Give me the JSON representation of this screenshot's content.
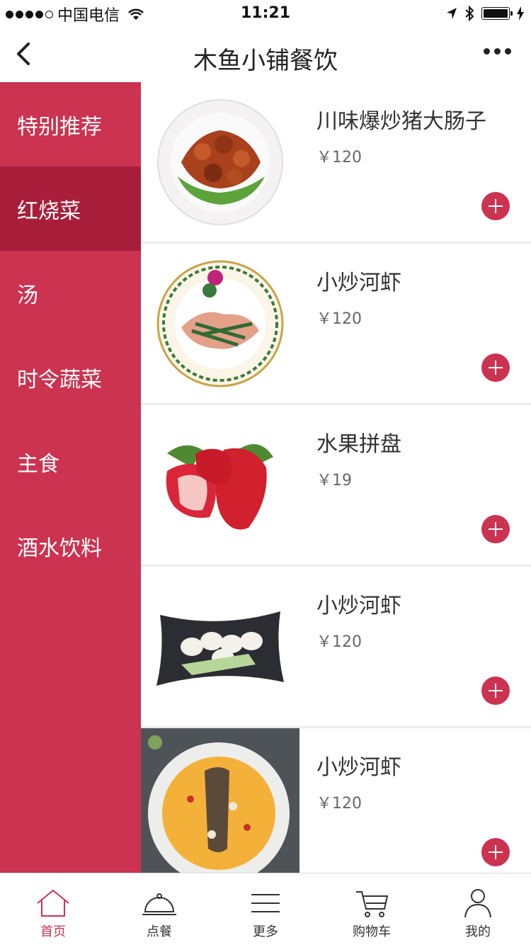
{
  "status": {
    "carrier": "中国电信",
    "time": "11:21"
  },
  "nav": {
    "title": "木鱼小铺餐饮"
  },
  "sidebar": {
    "items": [
      {
        "label": "特别推荐"
      },
      {
        "label": "红烧菜"
      },
      {
        "label": "汤"
      },
      {
        "label": "时令蔬菜"
      },
      {
        "label": "主食"
      },
      {
        "label": "酒水饮料"
      }
    ],
    "active_index": 1
  },
  "dishes": [
    {
      "name": "川味爆炒猪大肠子",
      "price": "￥120"
    },
    {
      "name": "小炒河虾",
      "price": "￥120"
    },
    {
      "name": "水果拼盘",
      "price": "￥19"
    },
    {
      "name": "小炒河虾",
      "price": "￥120"
    },
    {
      "name": "小炒河虾",
      "price": "￥120"
    }
  ],
  "tabs": [
    {
      "label": "首页"
    },
    {
      "label": "点餐"
    },
    {
      "label": "更多"
    },
    {
      "label": "购物车"
    },
    {
      "label": "我的"
    }
  ],
  "colors": {
    "accent": "#cb3350",
    "sidebar_active": "#a81e3a"
  }
}
